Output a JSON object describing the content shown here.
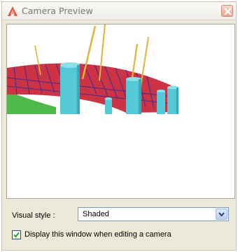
{
  "window": {
    "title": "Camera Preview",
    "title_icon": "autocad-a-icon",
    "close_icon": "close-icon"
  },
  "preview": {
    "description_icon": "3d-dome-scene"
  },
  "visual_style": {
    "label": "Visual style :",
    "value": "Shaded",
    "dropdown_icon": "chevron-down-icon"
  },
  "display_checkbox": {
    "label": "Display this window when editing a camera",
    "checked": true
  },
  "colors": {
    "dome": "#cc3344",
    "dome_lines": "#2a2a9a",
    "cylinder": "#55c8d8",
    "ground": "#4fb84a",
    "mast": "#e3b23c",
    "dialog_bg": "#ece9d8"
  }
}
